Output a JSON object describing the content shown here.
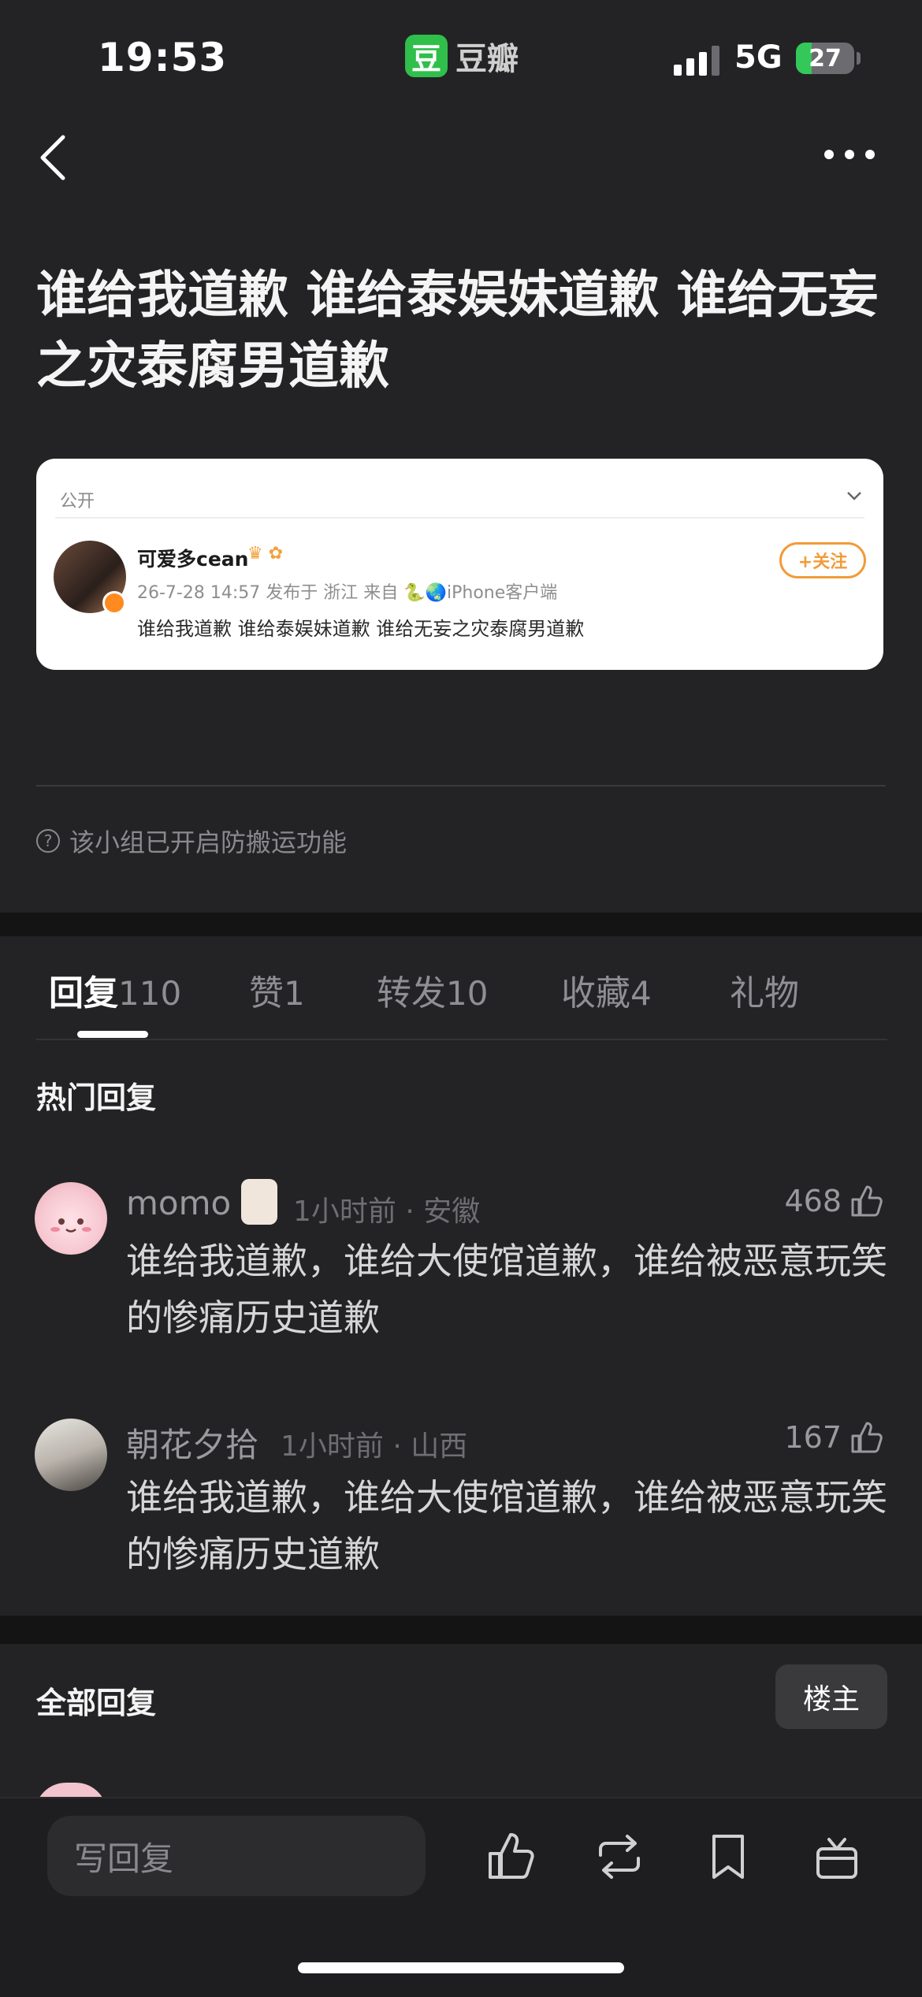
{
  "status_bar": {
    "time": "19:53",
    "app_badge": "豆",
    "app_name": "豆瓣",
    "network": "5G",
    "battery": "27",
    "battery_level_percent": 27
  },
  "post": {
    "title": "谁给我道歉 谁给泰娱妹道歉 谁给无妄之灾泰腐男道歉"
  },
  "embed": {
    "visibility": "公开",
    "user": "可爱多cean",
    "meta": "26-7-28 14:57 发布于 浙江  来自 🐍🌏iPhone客户端",
    "text": "谁给我道歉 谁给泰娱妹道歉 谁给无妄之灾泰腐男道歉",
    "follow_label": "+关注"
  },
  "notice": "该小组已开启防搬运功能",
  "tabs": [
    {
      "label": "回复",
      "count": "110"
    },
    {
      "label": "赞",
      "count": "1"
    },
    {
      "label": "转发",
      "count": "10"
    },
    {
      "label": "收藏",
      "count": "4"
    },
    {
      "label": "礼物",
      "count": ""
    }
  ],
  "hot_replies_title": "热门回复",
  "replies": [
    {
      "name": "momo",
      "meta": "1小时前 · 安徽",
      "likes": "468",
      "text": "谁给我道歉，谁给大使馆道歉，谁给被恶意玩笑的惨痛历史道歉"
    },
    {
      "name": "朝花夕拾",
      "meta": "1小时前 · 山西",
      "likes": "167",
      "text": "谁给我道歉，谁给大使馆道歉，谁给被恶意玩笑的惨痛历史道歉"
    }
  ],
  "all_replies_title": "全部回复",
  "op_filter": "楼主",
  "bottom_bar": {
    "reply_placeholder": "写回复"
  },
  "colors": {
    "background": "#232325",
    "accent_orange": "#f29b38",
    "brand_green": "#2fbf4a"
  }
}
